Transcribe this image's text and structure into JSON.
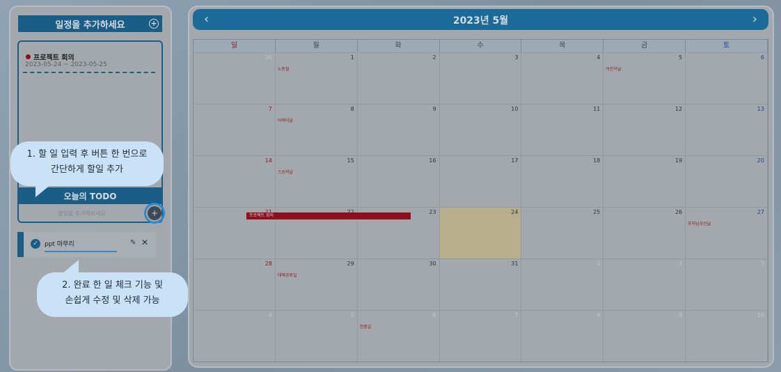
{
  "sidebar": {
    "add_schedule_label": "일정을 추가하세요",
    "schedule": {
      "title": "프로젝트 회의",
      "date_range": "2023-05-24 ~ 2023-05-25"
    },
    "todo_header": "오늘의 TODO",
    "todo_input_placeholder": "할일을 추가해보세요",
    "todo_items": [
      {
        "text": "ppt 마무리"
      }
    ]
  },
  "callouts": {
    "first": [
      "1. 할 일 입력 후 버튼 한 번으로",
      "간단하게 할일 추가"
    ],
    "second": [
      "2. 완료 한 일 체크 기능 및",
      "손쉽게 수정 및 삭제 가능"
    ]
  },
  "calendar": {
    "title": "2023년 5월",
    "prev": "‹",
    "next": "›",
    "weekdays": [
      "일",
      "월",
      "화",
      "수",
      "목",
      "금",
      "토"
    ],
    "weeks": [
      [
        {
          "d": "30",
          "dim": true
        },
        {
          "d": "1",
          "ev": "노동절"
        },
        {
          "d": "2"
        },
        {
          "d": "3"
        },
        {
          "d": "4"
        },
        {
          "d": "5",
          "ev": "어린이날"
        },
        {
          "d": "6"
        }
      ],
      [
        {
          "d": "7"
        },
        {
          "d": "8",
          "ev": "어버이날"
        },
        {
          "d": "9"
        },
        {
          "d": "10"
        },
        {
          "d": "11"
        },
        {
          "d": "12"
        },
        {
          "d": "13"
        }
      ],
      [
        {
          "d": "14"
        },
        {
          "d": "15",
          "ev": "스승의날"
        },
        {
          "d": "16"
        },
        {
          "d": "17"
        },
        {
          "d": "18"
        },
        {
          "d": "19"
        },
        {
          "d": "20"
        }
      ],
      [
        {
          "d": "21"
        },
        {
          "d": "22"
        },
        {
          "d": "23"
        },
        {
          "d": "24",
          "today": true
        },
        {
          "d": "25"
        },
        {
          "d": "26"
        },
        {
          "d": "27",
          "ev": "부처님오신날"
        }
      ],
      [
        {
          "d": "28"
        },
        {
          "d": "29",
          "ev": "대체공휴일"
        },
        {
          "d": "30"
        },
        {
          "d": "31"
        },
        {
          "d": "1",
          "dim": true
        },
        {
          "d": "2",
          "dim": true
        },
        {
          "d": "3",
          "dim": true
        }
      ],
      [
        {
          "d": "4",
          "dim": true
        },
        {
          "d": "5",
          "dim": true
        },
        {
          "d": "6",
          "dim": true,
          "ev": "현충일"
        },
        {
          "d": "7",
          "dim": true
        },
        {
          "d": "8",
          "dim": true
        },
        {
          "d": "9",
          "dim": true
        },
        {
          "d": "10",
          "dim": true
        }
      ]
    ],
    "event_bar": "프로젝트 회의"
  }
}
